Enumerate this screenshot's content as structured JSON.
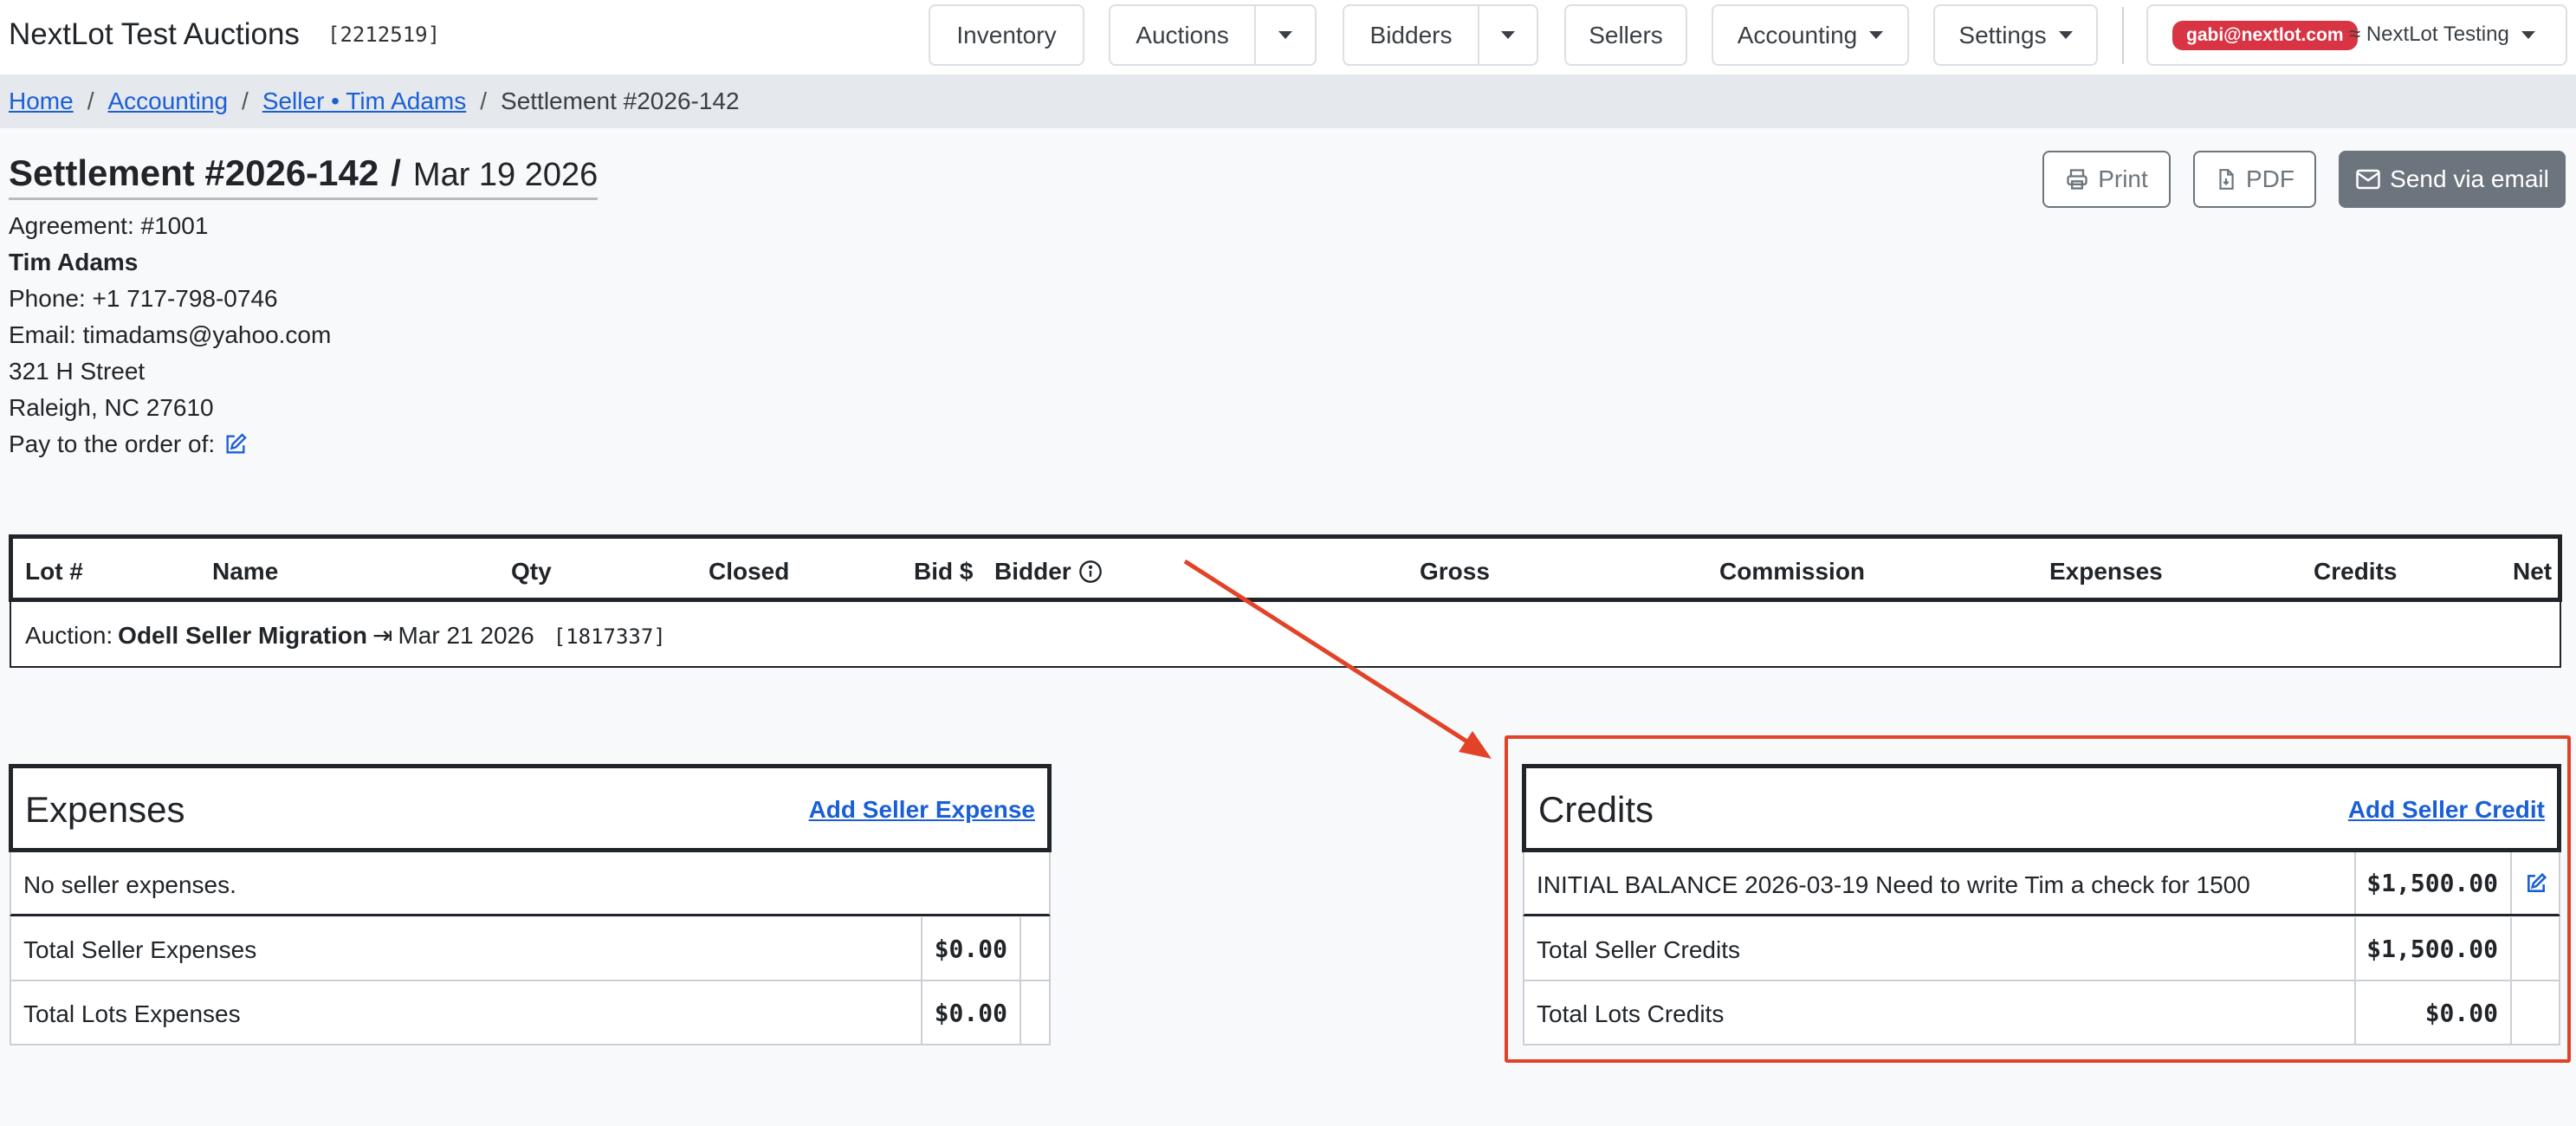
{
  "navbar": {
    "brand": "NextLot Test Auctions",
    "brand_id": "[2212519]",
    "items": {
      "inventory": "Inventory",
      "auctions": "Auctions",
      "bidders": "Bidders",
      "sellers": "Sellers",
      "accounting": "Accounting",
      "settings": "Settings"
    },
    "user_email": "gabi@nextlot.com",
    "tenant": "≈ NextLot Testing"
  },
  "breadcrumb": {
    "home": "Home",
    "accounting": "Accounting",
    "seller": "Seller • Tim Adams",
    "current": "Settlement #2026-142",
    "separator": "/"
  },
  "settlement": {
    "number": "Settlement #2026-142",
    "slash": "/",
    "date": "Mar 19 2026"
  },
  "actions": {
    "print": "Print",
    "pdf": "PDF",
    "email": "Send via email"
  },
  "seller": {
    "agreement": "Agreement: #1001",
    "name": "Tim Adams",
    "phone": "Phone: +1 717-798-0746",
    "email": "Email: timadams@yahoo.com",
    "address1": "321 H Street",
    "address2": "Raleigh, NC 27610",
    "pay_to": "Pay to the order of:"
  },
  "lots_table": {
    "columns": {
      "lot": "Lot #",
      "name": "Name",
      "qty": "Qty",
      "closed": "Closed",
      "bid": "Bid $",
      "bidder": "Bidder",
      "gross": "Gross",
      "commission": "Commission",
      "expenses": "Expenses",
      "credits": "Credits",
      "net": "Net"
    },
    "auction": {
      "prefix": "Auction:",
      "name": "Odell Seller Migration",
      "arrow": "⇥",
      "date": "Mar 21 2026",
      "id": "[1817337]"
    }
  },
  "expenses": {
    "title": "Expenses",
    "add_link": "Add Seller Expense",
    "empty": "No seller expenses.",
    "total_seller_label": "Total Seller Expenses",
    "total_seller_value": "$0.00",
    "total_lots_label": "Total Lots Expenses",
    "total_lots_value": "$0.00"
  },
  "credits": {
    "title": "Credits",
    "add_link": "Add Seller Credit",
    "rows": [
      {
        "description": "INITIAL BALANCE 2026-03-19 Need to write Tim a check for 1500",
        "amount": "$1,500.00"
      }
    ],
    "total_seller_label": "Total Seller Credits",
    "total_seller_value": "$1,500.00",
    "total_lots_label": "Total Lots Credits",
    "total_lots_value": "$0.00"
  },
  "colors": {
    "link": "#1a5fd6",
    "badge": "#d93444",
    "annotation": "#e24328",
    "secondary": "#6c757d"
  }
}
